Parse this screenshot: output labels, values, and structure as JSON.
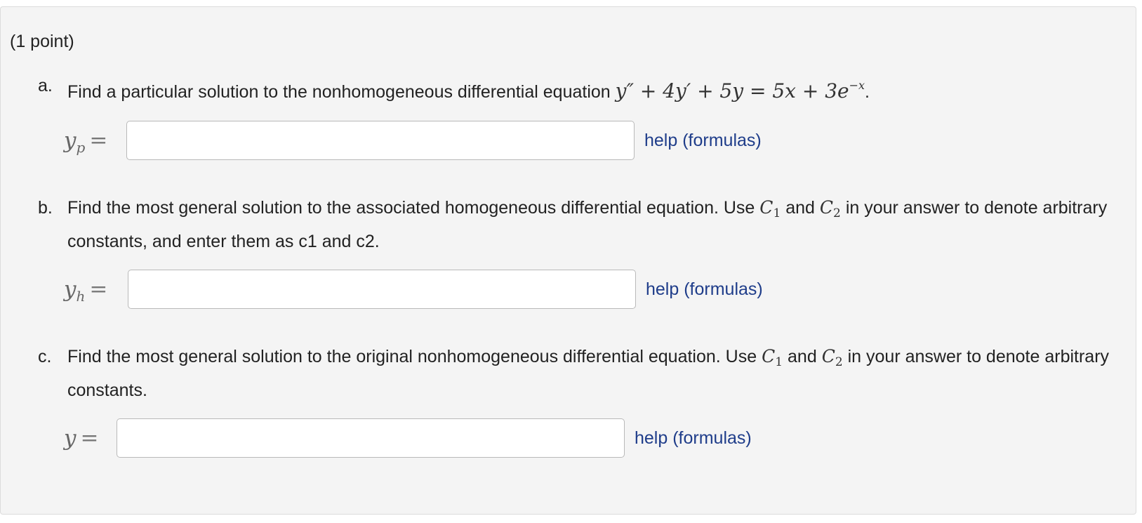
{
  "points": "(1 point)",
  "parts": [
    {
      "letter": "a.",
      "prompt": "Find a particular solution to the nonhomogeneous differential equation",
      "equation": "y″ + 4y′ + 5y = 5x + 3e",
      "equation_exp": "−x",
      "equation_end": ".",
      "answer_label": "y",
      "answer_sub": "p",
      "answer_eq": "=",
      "answer_value": "",
      "help": "help (formulas)"
    },
    {
      "letter": "b.",
      "prompt_1": "Find the most general solution to the associated homogeneous differential equation. Use",
      "c1": "C",
      "c1_sub": "1",
      "and": "and",
      "c2": "C",
      "c2_sub": "2",
      "prompt_2": "in your answer to denote arbitrary constants, and enter them as c1 and c2.",
      "answer_label": "y",
      "answer_sub": "h",
      "answer_eq": "=",
      "answer_value": "",
      "help": "help (formulas)"
    },
    {
      "letter": "c.",
      "prompt_1": "Find the most general solution to the original nonhomogeneous differential equation. Use",
      "c1": "C",
      "c1_sub": "1",
      "and": "and",
      "c2": "C",
      "c2_sub": "2",
      "prompt_2": "in your answer to denote arbitrary constants.",
      "answer_label": "y",
      "answer_eq": "=",
      "answer_value": "",
      "help": "help (formulas)"
    }
  ]
}
